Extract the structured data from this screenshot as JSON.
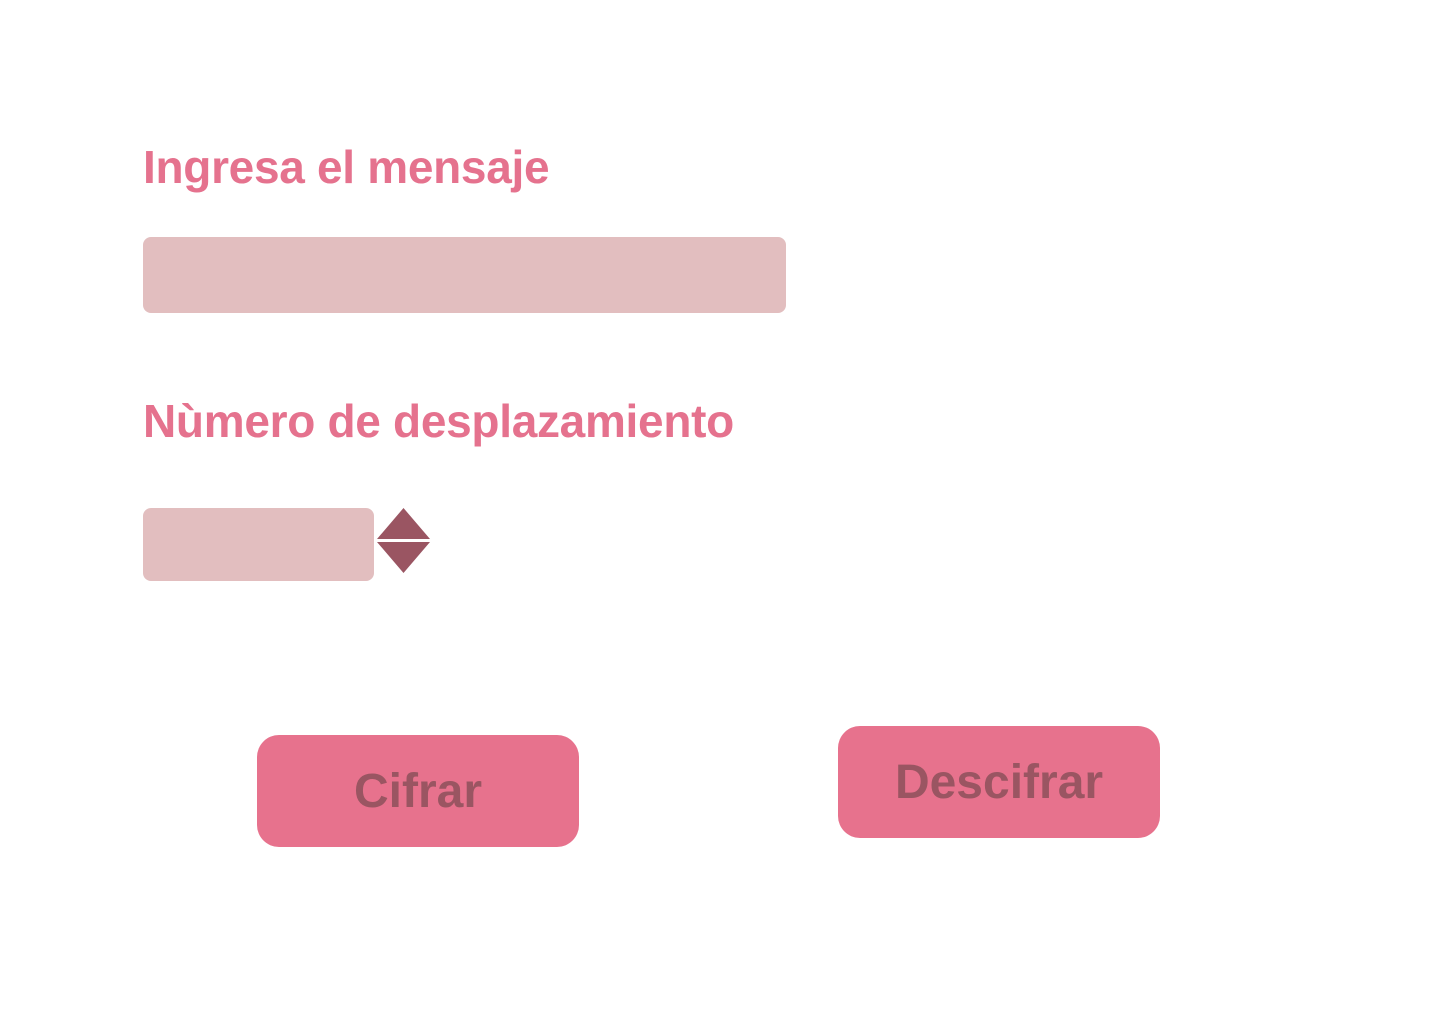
{
  "form": {
    "message_label": "Ingresa el mensaje",
    "message_value": "",
    "message_placeholder": "",
    "shift_label": "Nùmero de desplazamiento",
    "shift_value": "",
    "shift_placeholder": ""
  },
  "actions": {
    "encrypt_label": "Cifrar",
    "decrypt_label": "Descifrar"
  },
  "icons": {
    "stepper_up": "triangle-up-icon",
    "stepper_down": "triangle-down-icon"
  },
  "colors": {
    "background": "#ffffff",
    "label_text": "#e5728e",
    "input_fill": "#e2bebf",
    "stepper_arrow": "#9a5562",
    "button_fill": "#e7728d",
    "button_text": "#9a5562"
  }
}
